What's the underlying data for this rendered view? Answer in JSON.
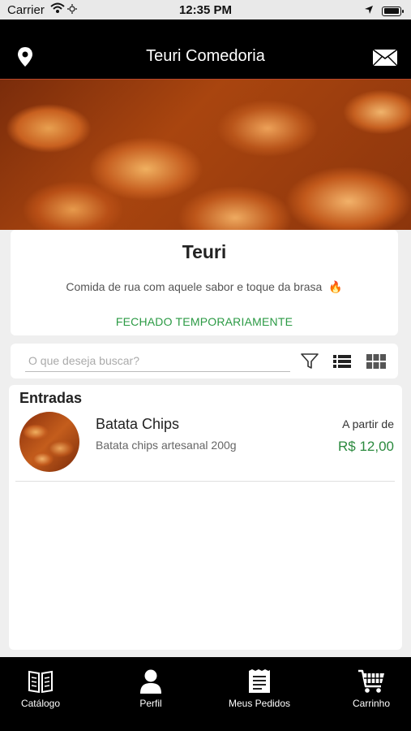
{
  "status_bar": {
    "carrier": "Carrier",
    "time": "12:35 PM",
    "battery_level": 0.95
  },
  "header": {
    "title": "Teuri Comedoria",
    "left_icon": "location-pin-icon",
    "right_icon": "mail-icon"
  },
  "hero": {
    "image": "potato-chips-photo"
  },
  "store": {
    "name": "Teuri",
    "description": "Comida de rua com aquele sabor e toque da brasa",
    "description_emoji": "🔥",
    "status": "FECHADO TEMPORARIAMENTE",
    "status_color": "#2b9a44"
  },
  "search": {
    "placeholder": "O que deseja buscar?",
    "value": ""
  },
  "toolbar": {
    "filter_icon": "filter-icon",
    "list_view_icon": "list-view-icon",
    "grid_view_icon": "grid-view-icon"
  },
  "catalog": {
    "section_title": "Entradas",
    "items": [
      {
        "name": "Batata Chips",
        "description": "Batata chips artesanal 200g",
        "price_prefix": "A partir de",
        "price": "R$ 12,00",
        "price_color": "#2b8a3e"
      }
    ]
  },
  "tabs": [
    {
      "label": "Catálogo",
      "icon": "catalog-book-icon"
    },
    {
      "label": "Perfil",
      "icon": "profile-user-icon"
    },
    {
      "label": "Meus Pedidos",
      "icon": "orders-receipt-icon"
    },
    {
      "label": "Carrinho",
      "icon": "cart-icon"
    }
  ]
}
